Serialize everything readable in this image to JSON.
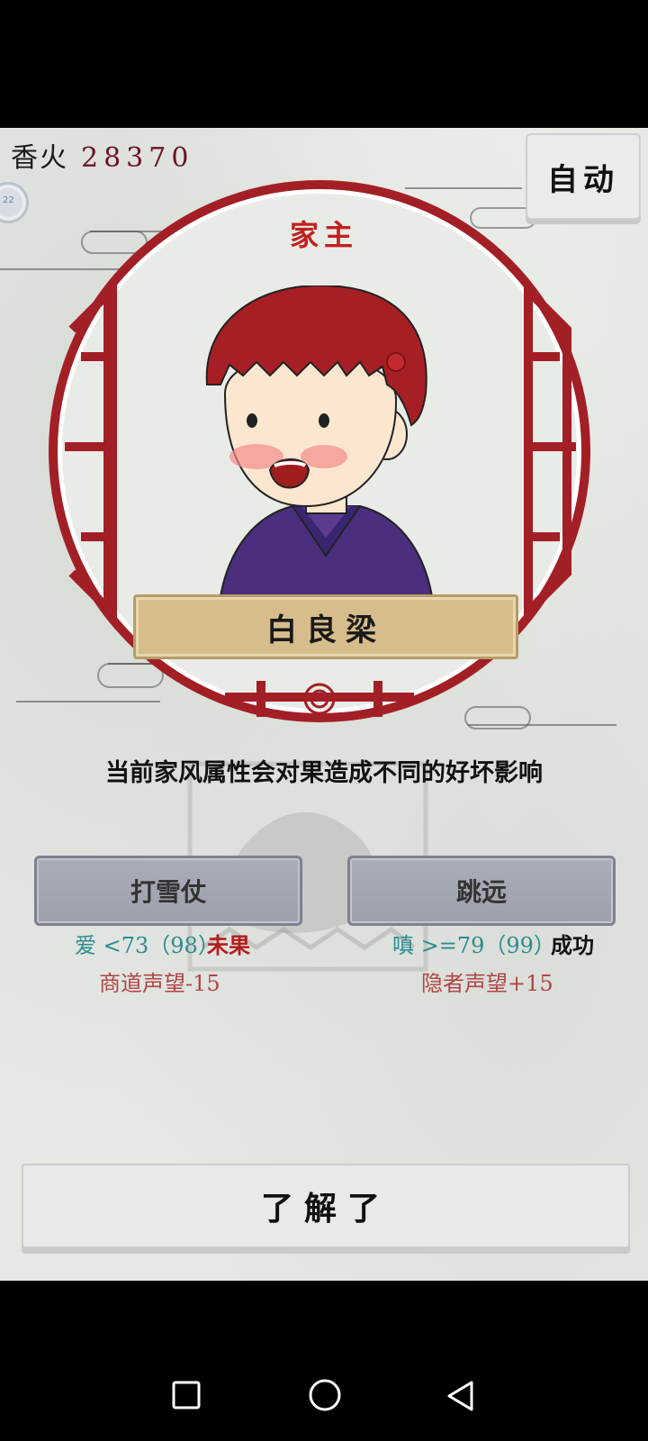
{
  "header": {
    "incense_label": "香火",
    "incense_value": "28370",
    "badge_text": "22",
    "auto_label": "自动"
  },
  "character": {
    "role": "家主",
    "name": "白良梁"
  },
  "event": {
    "hint": "当前家风属性会对果造成不同的好坏影响"
  },
  "choices": [
    {
      "label": "打雪仗",
      "requirement": "爱 <73（98）",
      "result": "未果",
      "result_color": "#b41c1c",
      "effect": "商道声望-15"
    },
    {
      "label": "跳远",
      "requirement": "嗔 >=79（99）",
      "result": "成功",
      "result_color": "#111111",
      "effect": "隐者声望+15"
    }
  ],
  "confirm_label": "了解了",
  "colors": {
    "frame_red": "#a31f26",
    "role_red": "#c0211e",
    "requirement_teal": "#2a8d91",
    "effect_red": "#b14546"
  },
  "navbar": {
    "icons": [
      "recent-apps-icon",
      "home-icon",
      "back-icon"
    ]
  }
}
